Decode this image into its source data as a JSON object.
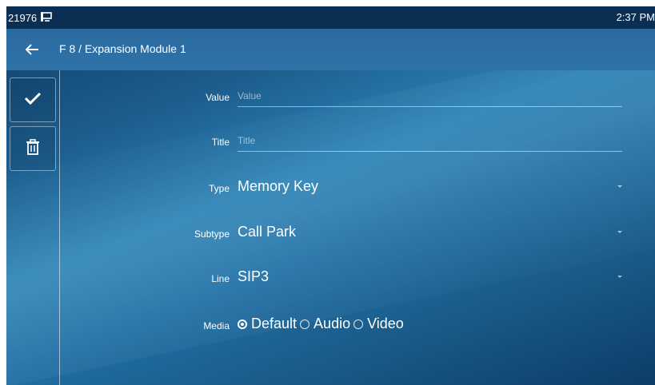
{
  "statusbar": {
    "extension": "21976",
    "device_icon": "desk-phone-icon",
    "time": "2:37 PM"
  },
  "header": {
    "back_icon": "arrow-left-icon",
    "title": "F 8 / Expansion Module 1"
  },
  "sidebar": {
    "save_icon": "checkmark-icon",
    "delete_icon": "trash-icon"
  },
  "form": {
    "value": {
      "label": "Value",
      "placeholder": "Value",
      "current": ""
    },
    "title": {
      "label": "Title",
      "placeholder": "Title",
      "current": ""
    },
    "type": {
      "label": "Type",
      "selected": "Memory Key"
    },
    "subtype": {
      "label": "Subtype",
      "selected": "Call Park"
    },
    "line": {
      "label": "Line",
      "selected": "SIP3"
    },
    "media": {
      "label": "Media",
      "options": [
        {
          "label": "Default",
          "checked": true
        },
        {
          "label": "Audio",
          "checked": false
        },
        {
          "label": "Video",
          "checked": false
        }
      ]
    }
  },
  "colors": {
    "statusbar_bg": "#0b2f52",
    "titlebar_bg": "#2f73a9",
    "text": "#ffffff"
  }
}
